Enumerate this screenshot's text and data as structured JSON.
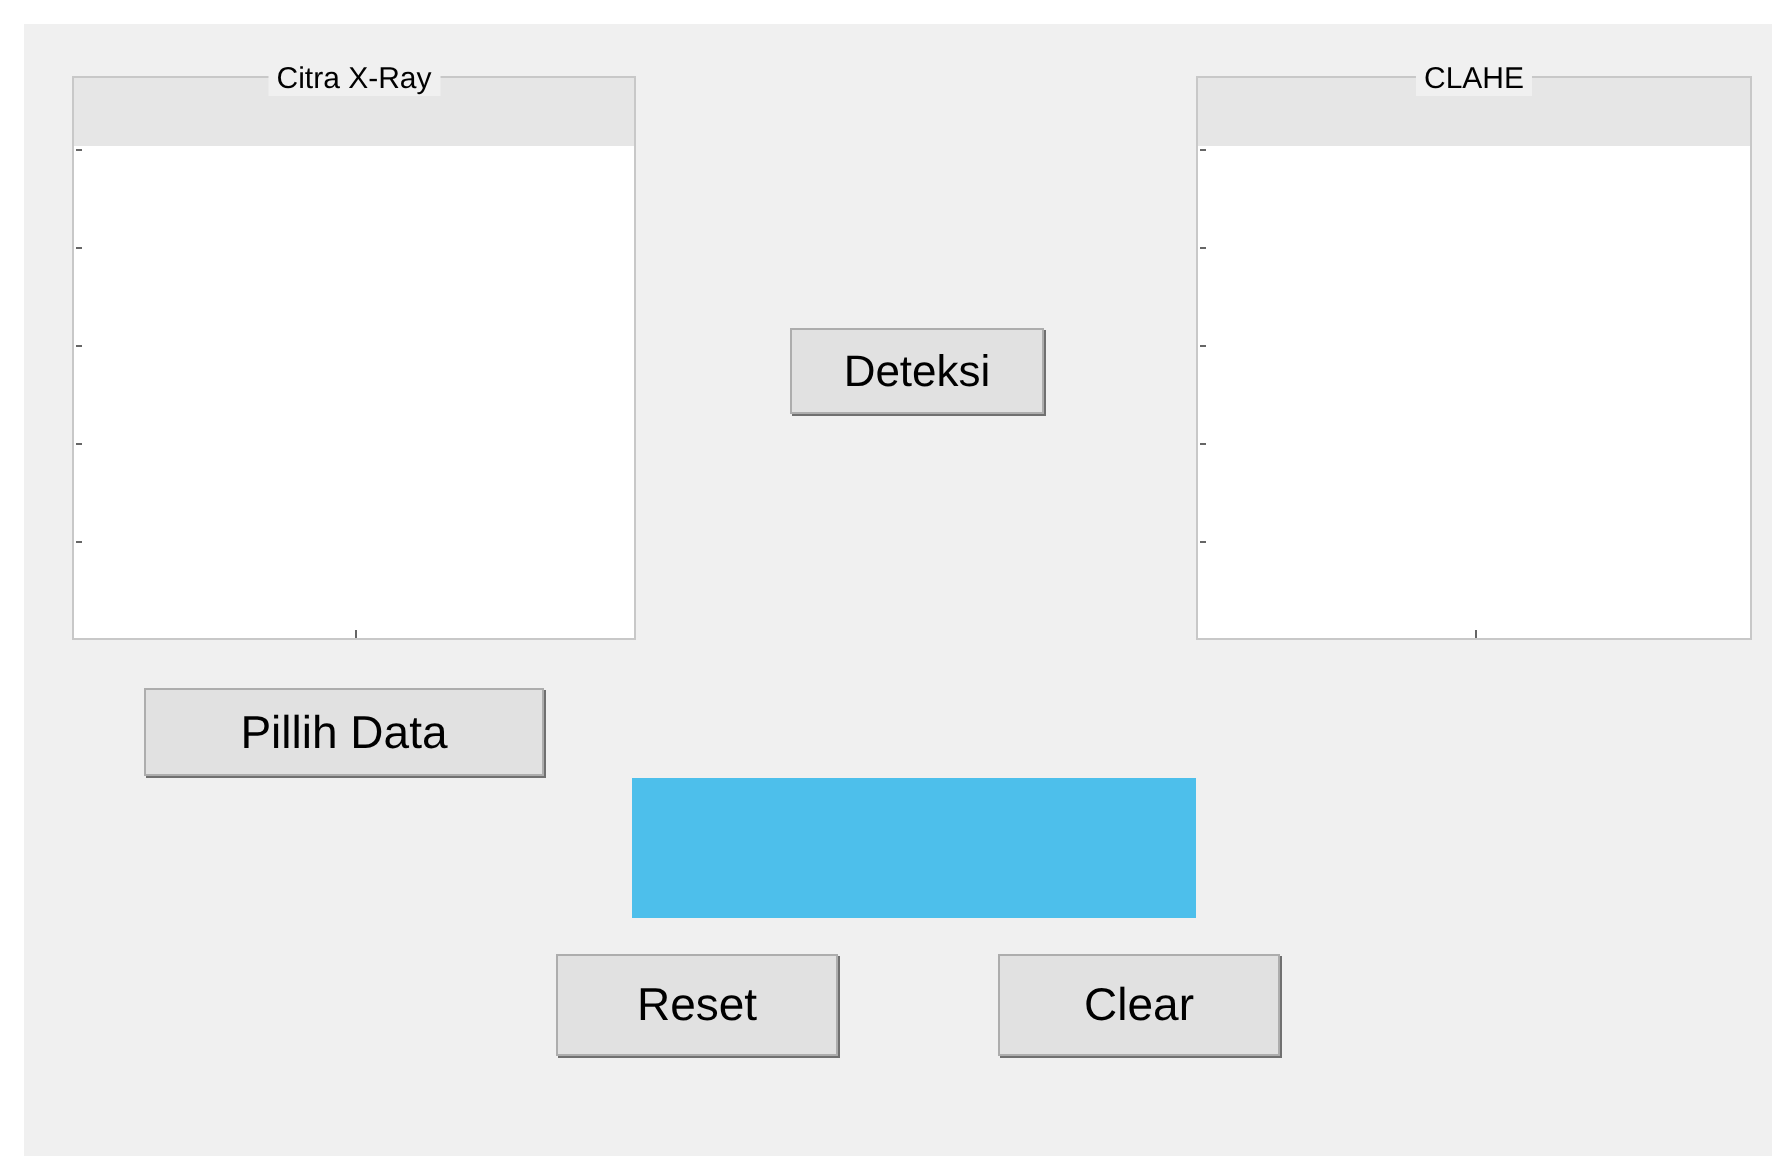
{
  "panels": [
    {
      "title": "Citra X-Ray"
    },
    {
      "title": "CLAHE"
    }
  ],
  "buttons": [
    {
      "label": "Deteksi"
    },
    {
      "label": "Pillih Data"
    },
    {
      "label": "Reset"
    },
    {
      "label": "Clear"
    }
  ]
}
